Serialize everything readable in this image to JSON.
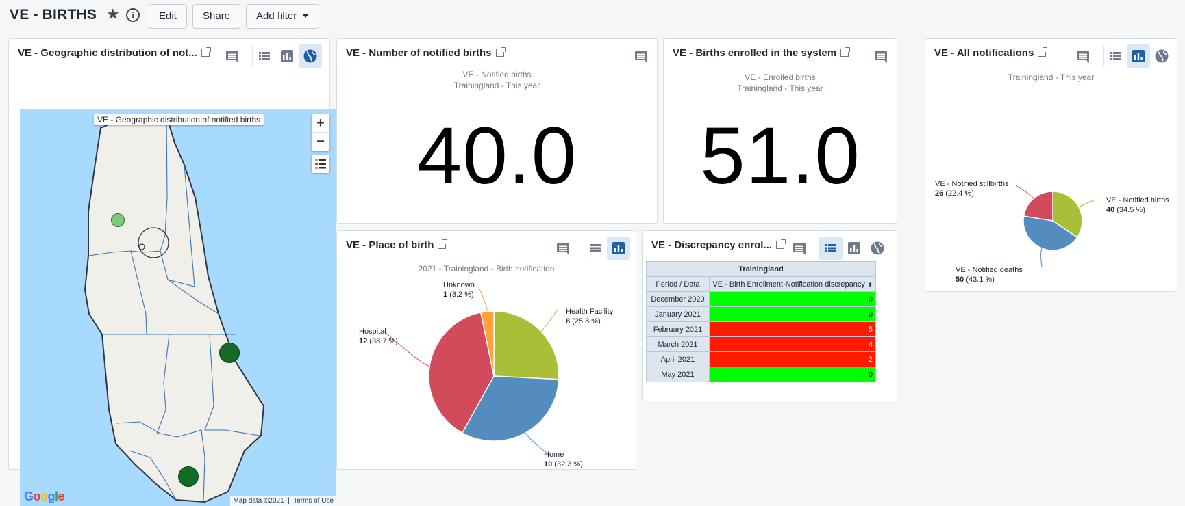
{
  "dashboard": {
    "title": "VE - BIRTHS",
    "edit_label": "Edit",
    "share_label": "Share",
    "add_filter_label": "Add filter"
  },
  "map_card": {
    "title": "VE - Geographic distribution of not...",
    "map_label": "VE - Geographic distribution of notified births",
    "zoom_in": "+",
    "zoom_out": "−",
    "google_logo": "Google",
    "attribution": "Map data ©2021",
    "terms": "Terms of Use",
    "points": [
      {
        "type": "light",
        "color": "#7ec87a"
      },
      {
        "type": "dark",
        "color": "#146b26"
      },
      {
        "type": "dark",
        "color": "#146b26"
      }
    ]
  },
  "notified_card": {
    "title": "VE - Number of notified births",
    "subtitle1": "VE - Notified births",
    "subtitle2": "Trainingland - This year",
    "value": "40.0"
  },
  "enrolled_card": {
    "title": "VE - Births enrolled in the system",
    "subtitle1": "VE - Enrolled births",
    "subtitle2": "Trainingland - This year",
    "value": "51.0"
  },
  "all_notifications_card": {
    "title": "VE - All notifications",
    "subtitle": "Trainingland - This year"
  },
  "place_card": {
    "title": "VE - Place of birth",
    "subtitle": "2021 - Trainingland - Birth notification"
  },
  "discrepancy_card": {
    "title": "VE - Discrepancy enrol...",
    "org_header": "Trainingland",
    "col_period": "Period / Data",
    "col_data": "VE - Birth Enrollment-Notification discrepancy",
    "rows": [
      {
        "period": "December 2020",
        "value": "0",
        "status": "ok"
      },
      {
        "period": "January 2021",
        "value": "0",
        "status": "ok"
      },
      {
        "period": "February 2021",
        "value": "5",
        "status": "bad"
      },
      {
        "period": "March 2021",
        "value": "4",
        "status": "bad"
      },
      {
        "period": "April 2021",
        "value": "2",
        "status": "bad"
      },
      {
        "period": "May 2021",
        "value": "0",
        "status": "ok"
      }
    ],
    "colors": {
      "ok": "#00ff00",
      "bad": "#ff1a00"
    }
  },
  "icons": {
    "comment": "comment-icon",
    "table": "table-icon",
    "chart": "chart-icon",
    "map": "globe-icon",
    "external": "external-link-icon",
    "star": "star-icon",
    "info": "info-icon"
  },
  "colors": {
    "accent": "#1f5ea8",
    "selected_bg": "#dbe9f7"
  },
  "chart_data": [
    {
      "type": "pie",
      "title": "VE - All notifications",
      "subtitle": "Trainingland - This year",
      "slices": [
        {
          "label": "VE - Notified births",
          "value": 40,
          "percent": "34.5 %",
          "color": "#a9bf38"
        },
        {
          "label": "VE - Notified deaths",
          "value": 50,
          "percent": "43.1 %",
          "color": "#558cc0"
        },
        {
          "label": "VE - Notified stillbirths",
          "value": 26,
          "percent": "22.4 %",
          "color": "#d24b5a"
        }
      ]
    },
    {
      "type": "pie",
      "title": "VE - Place of birth",
      "subtitle": "2021 - Trainingland - Birth notification",
      "slices": [
        {
          "label": "Health Facility",
          "value": 8,
          "percent": "25.8 %",
          "color": "#a9bf38"
        },
        {
          "label": "Home",
          "value": 10,
          "percent": "32.3 %",
          "color": "#558cc0"
        },
        {
          "label": "Hospital",
          "value": 12,
          "percent": "38.7 %",
          "color": "#d24b5a"
        },
        {
          "label": "Unknown",
          "value": 1,
          "percent": "3.2 %",
          "color": "#ffa23a"
        }
      ]
    }
  ]
}
